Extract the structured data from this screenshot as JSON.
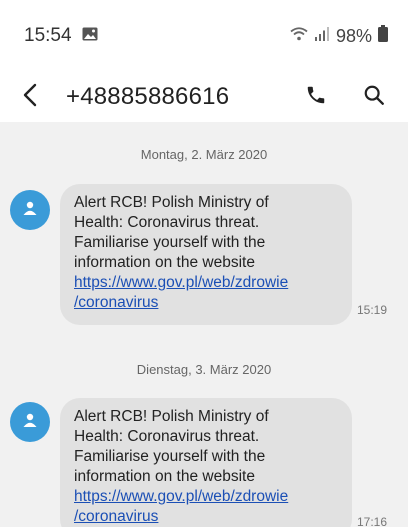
{
  "status_bar": {
    "time": "15:54",
    "battery": "98%",
    "icons": [
      "gallery-notification-icon",
      "wifi-icon",
      "signal-icon",
      "battery-icon"
    ]
  },
  "header": {
    "title": "+48885886616",
    "icons": [
      "back-arrow-icon",
      "phone-icon",
      "search-icon"
    ]
  },
  "messages": [
    {
      "date": "Montag, 2. März 2020",
      "text_lines": [
        "Alert RCB! Polish Ministry of",
        "Health: Coronavirus threat.",
        "Familiarise yourself with the",
        "information on the website"
      ],
      "link_lines": [
        "https://www.gov.pl/web/zdrowie",
        "/coronavirus"
      ],
      "time": "15:19"
    },
    {
      "date": "Dienstag, 3. März 2020",
      "text_lines": [
        "Alert RCB! Polish Ministry of",
        "Health: Coronavirus threat.",
        "Familiarise yourself with the",
        "information on the website"
      ],
      "link_lines": [
        "https://www.gov.pl/web/zdrowie",
        "/coronavirus"
      ],
      "time": "17:16"
    }
  ],
  "colors": {
    "chat_background": "#f1f1f1",
    "bubble": "#e1e1e1",
    "avatar": "#3a9bd8",
    "link": "#1b4fb5"
  }
}
